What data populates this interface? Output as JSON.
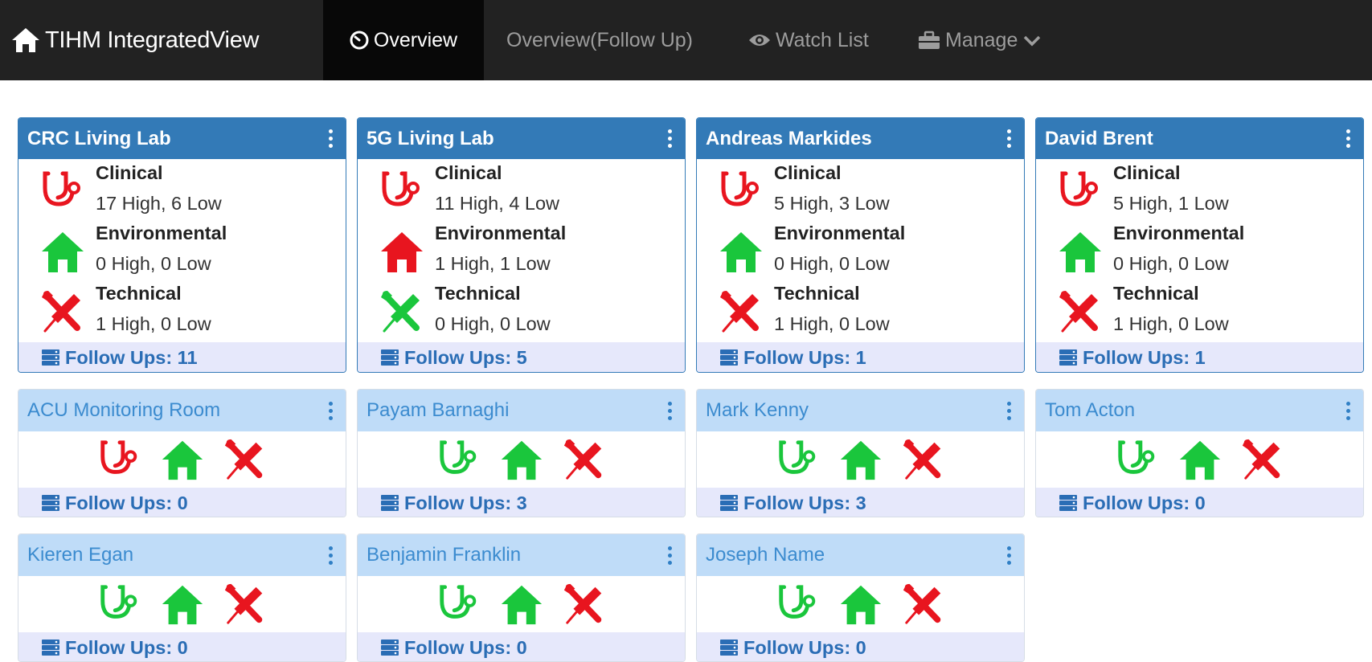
{
  "brand": {
    "title": "TIHM IntegratedView"
  },
  "nav": {
    "overview": "Overview",
    "overview_followup": "Overview(Follow Up)",
    "watchlist": "Watch List",
    "manage": "Manage"
  },
  "colors": {
    "alert": "#e8151f",
    "ok": "#1ac63c",
    "header_blue": "#337ab7",
    "compact_header": "#bfdcf8",
    "footer": "#e6e8fb"
  },
  "full_cards": [
    {
      "title": "CRC Living Lab",
      "alerts": [
        {
          "category": "Clinical",
          "summary": "17 High, 6 Low",
          "status": "alert"
        },
        {
          "category": "Environmental",
          "summary": "0 High, 0 Low",
          "status": "ok"
        },
        {
          "category": "Technical",
          "summary": "1 High, 0 Low",
          "status": "alert"
        }
      ],
      "followups": "Follow Ups: 11"
    },
    {
      "title": "5G Living Lab",
      "alerts": [
        {
          "category": "Clinical",
          "summary": "11 High, 4 Low",
          "status": "alert"
        },
        {
          "category": "Environmental",
          "summary": "1 High, 1 Low",
          "status": "alert"
        },
        {
          "category": "Technical",
          "summary": "0 High, 0 Low",
          "status": "ok"
        }
      ],
      "followups": "Follow Ups: 5"
    },
    {
      "title": "Andreas Markides",
      "alerts": [
        {
          "category": "Clinical",
          "summary": "5 High, 3 Low",
          "status": "alert"
        },
        {
          "category": "Environmental",
          "summary": "0 High, 0 Low",
          "status": "ok"
        },
        {
          "category": "Technical",
          "summary": "1 High, 0 Low",
          "status": "alert"
        }
      ],
      "followups": "Follow Ups: 1"
    },
    {
      "title": "David Brent",
      "alerts": [
        {
          "category": "Clinical",
          "summary": "5 High, 1 Low",
          "status": "alert"
        },
        {
          "category": "Environmental",
          "summary": "0 High, 0 Low",
          "status": "ok"
        },
        {
          "category": "Technical",
          "summary": "1 High, 0 Low",
          "status": "alert"
        }
      ],
      "followups": "Follow Ups: 1"
    }
  ],
  "compact_cards": [
    {
      "title": "ACU Monitoring Room",
      "clinical": "alert",
      "environmental": "ok",
      "technical": "alert",
      "followups": "Follow Ups: 0"
    },
    {
      "title": "Payam Barnaghi",
      "clinical": "ok",
      "environmental": "ok",
      "technical": "alert",
      "followups": "Follow Ups: 3"
    },
    {
      "title": "Mark Kenny",
      "clinical": "ok",
      "environmental": "ok",
      "technical": "alert",
      "followups": "Follow Ups: 3"
    },
    {
      "title": "Tom Acton",
      "clinical": "ok",
      "environmental": "ok",
      "technical": "alert",
      "followups": "Follow Ups: 0"
    },
    {
      "title": "Kieren Egan",
      "clinical": "ok",
      "environmental": "ok",
      "technical": "alert",
      "followups": "Follow Ups: 0"
    },
    {
      "title": "Benjamin Franklin",
      "clinical": "ok",
      "environmental": "ok",
      "technical": "alert",
      "followups": "Follow Ups: 0"
    },
    {
      "title": "Joseph Name",
      "clinical": "ok",
      "environmental": "ok",
      "technical": "alert",
      "followups": "Follow Ups: 0"
    }
  ],
  "icons": {
    "clinical": "stethoscope-icon",
    "environmental": "home-icon",
    "technical": "wrench-screwdriver-icon",
    "followups": "server-list-icon",
    "menu": "kebab-menu-icon"
  }
}
